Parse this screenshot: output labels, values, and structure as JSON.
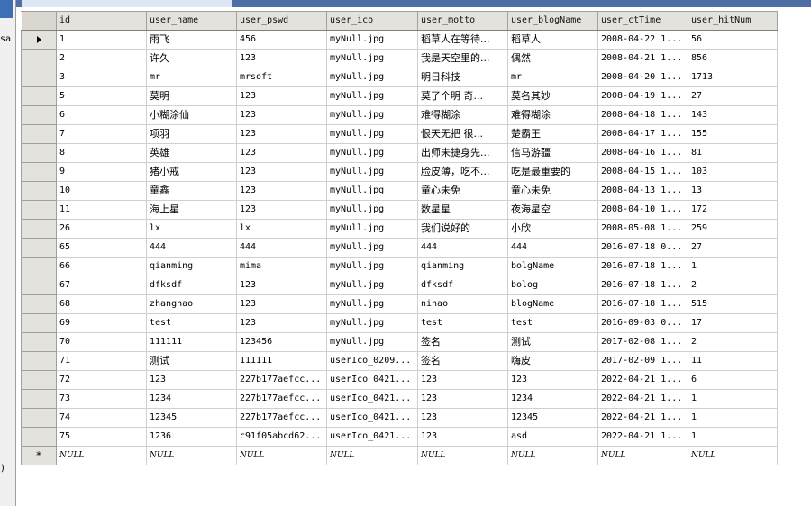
{
  "sidebar": {
    "text_top": "sa",
    "text_bottom": ")"
  },
  "tab": {
    "title": ""
  },
  "grid": {
    "columns": [
      "id",
      "user_name",
      "user_pswd",
      "user_ico",
      "user_motto",
      "user_blogName",
      "user_ctTime",
      "user_hitNum"
    ],
    "rows": [
      [
        "1",
        "雨飞",
        "456",
        "myNull.jpg",
        "稻草人在等待...",
        "稻草人",
        "2008-04-22 1...",
        "56"
      ],
      [
        "2",
        "许久",
        "123",
        "myNull.jpg",
        "我是天空里的...",
        "偶然",
        "2008-04-21 1...",
        "856"
      ],
      [
        "3",
        "mr",
        "mrsoft",
        "myNull.jpg",
        "明日科技",
        "mr",
        "2008-04-20 1...",
        "1713"
      ],
      [
        "5",
        "莫明",
        "123",
        "myNull.jpg",
        "莫了个明 奇...",
        "莫名其妙",
        "2008-04-19 1...",
        "27"
      ],
      [
        "6",
        "小糊涂仙",
        "123",
        "myNull.jpg",
        "难得糊涂",
        "难得糊涂",
        "2008-04-18 1...",
        "143"
      ],
      [
        "7",
        "项羽",
        "123",
        "myNull.jpg",
        "恨天无把 很...",
        "楚霸王",
        "2008-04-17 1...",
        "155"
      ],
      [
        "8",
        "英雄",
        "123",
        "myNull.jpg",
        "出师未捷身先...",
        "信马游疆",
        "2008-04-16 1...",
        "81"
      ],
      [
        "9",
        "猪小戒",
        "123",
        "myNull.jpg",
        "脸皮薄，吃不...",
        "吃是最重要的",
        "2008-04-15 1...",
        "103"
      ],
      [
        "10",
        "童鑫",
        "123",
        "myNull.jpg",
        "童心未免",
        "童心未免",
        "2008-04-13 1...",
        "13"
      ],
      [
        "11",
        "海上星",
        "123",
        "myNull.jpg",
        "数星星",
        "夜海星空",
        "2008-04-10 1...",
        "172"
      ],
      [
        "26",
        "lx",
        "lx",
        "myNull.jpg",
        "我们说好的",
        "小欣",
        "2008-05-08 1...",
        "259"
      ],
      [
        "65",
        "444",
        "444",
        "myNull.jpg",
        "444",
        "444",
        "2016-07-18 0...",
        "27"
      ],
      [
        "66",
        "qianming",
        "mima",
        "myNull.jpg",
        "qianming",
        "bolgName",
        "2016-07-18 1...",
        "1"
      ],
      [
        "67",
        "dfksdf",
        "123",
        "myNull.jpg",
        "dfksdf",
        "bolog",
        "2016-07-18 1...",
        "2"
      ],
      [
        "68",
        "zhanghao",
        "123",
        "myNull.jpg",
        "nihao",
        "blogName",
        "2016-07-18 1...",
        "515"
      ],
      [
        "69",
        "test",
        "123",
        "myNull.jpg",
        "test",
        "test",
        "2016-09-03 0...",
        "17"
      ],
      [
        "70",
        "111111",
        "123456",
        "myNull.jpg",
        "签名",
        "测试",
        "2017-02-08 1...",
        "2"
      ],
      [
        "71",
        "测试",
        "111111",
        "userIco_0209...",
        "签名",
        "嗨皮",
        "2017-02-09 1...",
        "11"
      ],
      [
        "72",
        "123",
        "227b177aefcc...",
        "userIco_0421...",
        "123",
        "123",
        "2022-04-21 1...",
        "6"
      ],
      [
        "73",
        "1234",
        "227b177aefcc...",
        "userIco_0421...",
        "123",
        "1234",
        "2022-04-21 1...",
        "1"
      ],
      [
        "74",
        "12345",
        "227b177aefcc...",
        "userIco_0421...",
        "123",
        "12345",
        "2022-04-21 1...",
        "1"
      ],
      [
        "75",
        "1236",
        "c91f05abcd62...",
        "userIco_0421...",
        "123",
        "asd",
        "2022-04-21 1...",
        "1"
      ]
    ],
    "new_row_marker": "*",
    "null_text": "NULL"
  }
}
